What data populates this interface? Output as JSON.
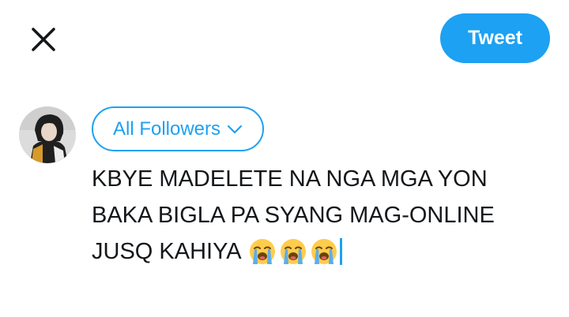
{
  "header": {
    "close_icon": "close-icon",
    "tweet_label": "Tweet"
  },
  "composer": {
    "avatar": "user-avatar",
    "audience_label": "All Followers",
    "audience_icon": "chevron-down-icon",
    "text_lines": [
      "KBYE MADELETE NA NGA MGA YON",
      "BAKA BIGLA PA SYANG MAG-ONLINE",
      "JUSQ KAHIYA"
    ],
    "emojis": [
      "loudly-crying-face",
      "loudly-crying-face",
      "loudly-crying-face"
    ]
  },
  "colors": {
    "accent": "#1da1f2",
    "text": "#14171a"
  }
}
